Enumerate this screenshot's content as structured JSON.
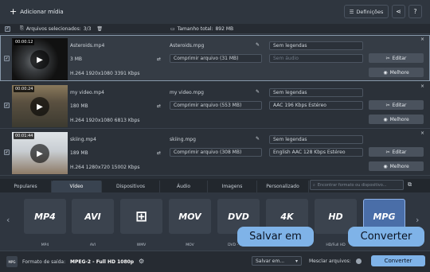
{
  "toolbar": {
    "add_media": "Adicionar mídia",
    "settings": "Definições"
  },
  "status": {
    "selected_label": "Arquivos selecionados:",
    "selected_value": "3/3",
    "total_label": "Tamanho total:",
    "total_value": "892 MB"
  },
  "files": [
    {
      "time": "00:00:12",
      "name": "Asteroids.mp4",
      "size": "3 MB",
      "codec": "H.264 1920x1080 3391 Kbps",
      "output_name": "Asteroids.mpg",
      "compress": "Comprimir arquivo (31 MB)",
      "subtitles": "Sem legendas",
      "audio": "Sem áudio",
      "edit": "Editar",
      "enhance": "Melhore"
    },
    {
      "time": "00:00:24",
      "name": "my video.mp4",
      "size": "180 MB",
      "codec": "H.264 1920x1080 6813 Kbps",
      "output_name": "my video.mpg",
      "compress": "Comprimir arquivo (553 MB)",
      "subtitles": "Sem legendas",
      "audio": "AAC 196 Kbps Estéreo",
      "edit": "Editar",
      "enhance": "Melhore"
    },
    {
      "time": "00:01:44",
      "name": "skiing.mp4",
      "size": "189 MB",
      "codec": "H.264 1280x720 15002 Kbps",
      "output_name": "skiing.mpg",
      "compress": "Comprimir arquivo (308 MB)",
      "subtitles": "Sem legendas",
      "audio": "English AAC 128 Kbps Estéreo",
      "edit": "Editar",
      "enhance": "Melhore"
    }
  ],
  "tabs": [
    "Populares",
    "Vídeo",
    "Dispositivos",
    "Áudio",
    "Imagens",
    "Personalizado"
  ],
  "active_tab": "Vídeo",
  "search_placeholder": "Encontrar formato ou dispositivo...",
  "formats": [
    {
      "logo": "MP4",
      "label": "MP4"
    },
    {
      "logo": "AVI",
      "label": "AVI"
    },
    {
      "logo": "WMV",
      "label": "WMV"
    },
    {
      "logo": "MOV",
      "label": "MOV"
    },
    {
      "logo": "DVD",
      "label": "DVD - vídeo"
    },
    {
      "logo": "4K",
      "label": ""
    },
    {
      "logo": "HD",
      "label": "HD/Full HD"
    },
    {
      "logo": "MPG",
      "label": ""
    }
  ],
  "output": {
    "format_label": "Formato de saída:",
    "format_value": "MPEG-2 - Full HD 1080p",
    "save_to": "Salvar em...",
    "merge": "Mesclar arquivos:",
    "convert": "Converter"
  },
  "tooltips": {
    "save": "Salvar em",
    "convert": "Converter"
  },
  "colors": {
    "accent": "#7fb3e8",
    "selected_format": "#4a6ea8"
  }
}
